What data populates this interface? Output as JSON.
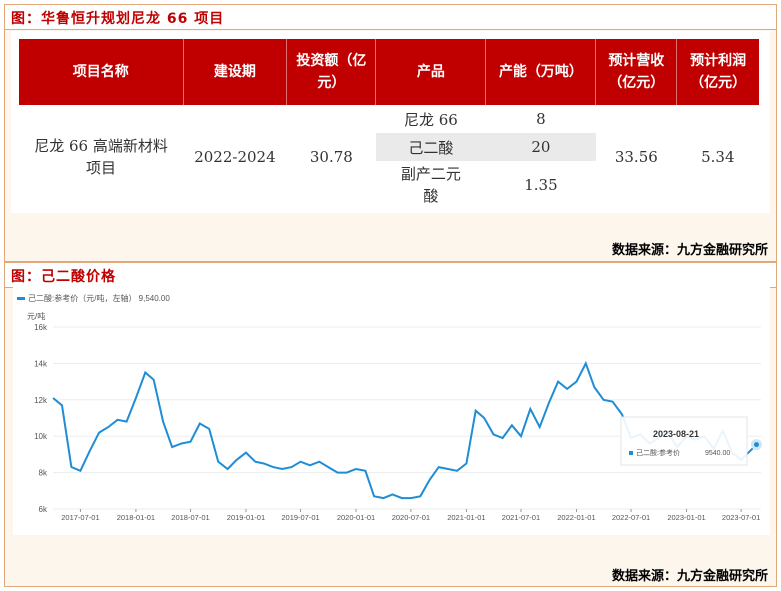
{
  "figure1": {
    "title": "图：华鲁恒升规划尼龙 66 项目",
    "source": "数据来源：九方金融研究所",
    "headers": [
      "项目名称",
      "建设期",
      "投资额（亿元）",
      "产品",
      "产能（万吨）",
      "预计营收（亿元）",
      "预计利润（亿元）"
    ],
    "row": {
      "name": "尼龙 66 高端新材料项目",
      "period": "2022-2024",
      "investment": "30.78",
      "products": [
        "尼龙 66",
        "己二酸",
        "副产二元酸"
      ],
      "capacity": [
        "8",
        "20",
        "1.35"
      ],
      "revenue": "33.56",
      "profit": "5.34"
    }
  },
  "figure2": {
    "title": "图：己二酸价格",
    "source": "数据来源：九方金融研究所",
    "legend": "己二酸:参考价（元/吨，左轴） 9,540.00",
    "ylabel": "元/吨",
    "tooltip": {
      "date": "2023-08-21",
      "series": "己二酸:参考价",
      "value": "9540.00"
    }
  },
  "chart_data": {
    "type": "line",
    "ylabel": "元/吨",
    "ylim": [
      6000,
      16000
    ],
    "yticks": [
      "6k",
      "8k",
      "10k",
      "12k",
      "14k",
      "16k"
    ],
    "xticks": [
      "2017-07-01",
      "2018-01-01",
      "2018-07-01",
      "2019-01-01",
      "2019-07-01",
      "2020-01-01",
      "2020-07-01",
      "2021-01-01",
      "2021-07-01",
      "2022-01-01",
      "2022-07-01",
      "2023-01-01",
      "2023-07-01"
    ],
    "grid": true,
    "legend_position": "top-left",
    "series": [
      {
        "name": "己二酸:参考价（元/吨，左轴）",
        "color": "#1f8dd6",
        "x": [
          "2017-04-01",
          "2017-05-01",
          "2017-06-01",
          "2017-07-01",
          "2017-08-01",
          "2017-09-01",
          "2017-10-01",
          "2017-11-01",
          "2017-12-01",
          "2018-01-01",
          "2018-02-01",
          "2018-03-01",
          "2018-04-01",
          "2018-05-01",
          "2018-06-01",
          "2018-07-01",
          "2018-08-01",
          "2018-09-01",
          "2018-10-01",
          "2018-11-01",
          "2018-12-01",
          "2019-01-01",
          "2019-02-01",
          "2019-03-01",
          "2019-04-01",
          "2019-05-01",
          "2019-06-01",
          "2019-07-01",
          "2019-08-01",
          "2019-09-01",
          "2019-10-01",
          "2019-11-01",
          "2019-12-01",
          "2020-01-01",
          "2020-02-01",
          "2020-03-01",
          "2020-04-01",
          "2020-05-01",
          "2020-06-01",
          "2020-07-01",
          "2020-08-01",
          "2020-09-01",
          "2020-10-01",
          "2020-11-01",
          "2020-12-01",
          "2021-01-01",
          "2021-02-01",
          "2021-03-01",
          "2021-04-01",
          "2021-05-01",
          "2021-06-01",
          "2021-07-01",
          "2021-08-01",
          "2021-09-01",
          "2021-10-01",
          "2021-11-01",
          "2021-12-01",
          "2022-01-01",
          "2022-02-01",
          "2022-03-01",
          "2022-04-01",
          "2022-05-01",
          "2022-06-01",
          "2022-07-01",
          "2022-08-01",
          "2022-09-01",
          "2022-10-01",
          "2022-11-01",
          "2022-12-01",
          "2023-01-01",
          "2023-02-01",
          "2023-03-01",
          "2023-04-01",
          "2023-05-01",
          "2023-06-01",
          "2023-07-01",
          "2023-08-21"
        ],
        "values": [
          12100,
          11700,
          8300,
          8100,
          9200,
          10200,
          10500,
          10900,
          10800,
          12100,
          13500,
          13100,
          10800,
          9400,
          9600,
          9700,
          10700,
          10400,
          8600,
          8200,
          8700,
          9100,
          8600,
          8500,
          8300,
          8200,
          8300,
          8600,
          8400,
          8600,
          8300,
          8000,
          8000,
          8200,
          8100,
          6700,
          6600,
          6800,
          6600,
          6600,
          6700,
          7600,
          8300,
          8200,
          8100,
          8500,
          11400,
          11000,
          10100,
          9900,
          10600,
          10000,
          11500,
          10500,
          11800,
          13000,
          12600,
          13000,
          14000,
          12700,
          12000,
          11900,
          11200,
          9900,
          10100,
          9600,
          9900,
          10200,
          9400,
          10000,
          9800,
          10000,
          9300,
          10300,
          9100,
          8700,
          9540
        ]
      }
    ]
  }
}
